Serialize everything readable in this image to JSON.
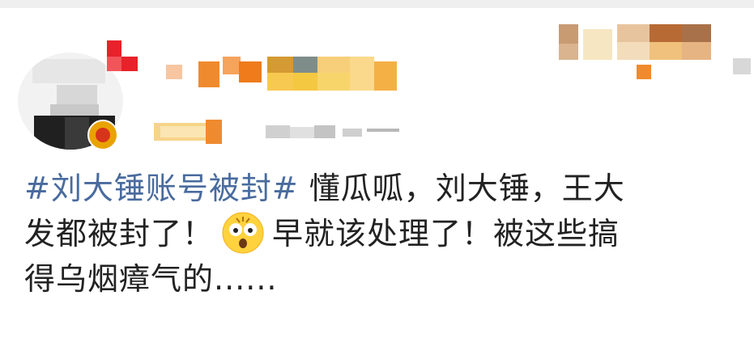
{
  "post": {
    "hashtag": "#刘大锤账号被封#",
    "text_line1": "懂瓜呱，刘大锤，王大",
    "text_line2_a": "发都被封了！",
    "text_line2_b": "早就该处理了！被这些搞",
    "text_line3": "得乌烟瘴气的......",
    "emoji": "shocked-face-emoji"
  },
  "colors": {
    "hashtag": "#496b9e",
    "text": "#222222",
    "blur_orange": "#f08a2e",
    "blur_yellow": "#f5c842"
  }
}
